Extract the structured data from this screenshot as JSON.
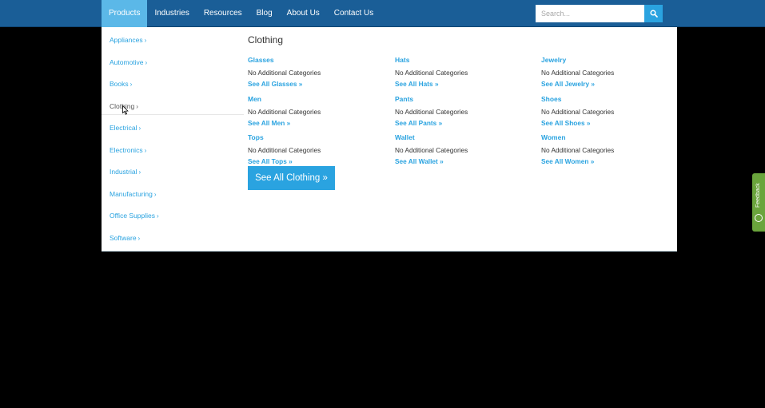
{
  "nav": {
    "items": [
      "Products",
      "Industries",
      "Resources",
      "Blog",
      "About Us",
      "Contact Us"
    ],
    "active_index": 0
  },
  "search": {
    "placeholder": "Search...",
    "icon": "search-icon"
  },
  "categories": {
    "items": [
      "Appliances",
      "Automotive",
      "Books",
      "Clothing",
      "Electrical",
      "Electronics",
      "Industrial",
      "Manufacturing",
      "Office Supplies",
      "Software"
    ],
    "active": "Clothing",
    "chevron": "›"
  },
  "content": {
    "title": "Clothing",
    "subcategories": [
      {
        "name": "Glasses",
        "note": "No Additional Categories",
        "see_all": "See All Glasses »"
      },
      {
        "name": "Hats",
        "note": "No Additional Categories",
        "see_all": "See All Hats »"
      },
      {
        "name": "Jewelry",
        "note": "No Additional Categories",
        "see_all": "See All Jewelry »"
      },
      {
        "name": "Men",
        "note": "No Additional Categories",
        "see_all": "See All Men »"
      },
      {
        "name": "Pants",
        "note": "No Additional Categories",
        "see_all": "See All Pants »"
      },
      {
        "name": "Shoes",
        "note": "No Additional Categories",
        "see_all": "See All Shoes »"
      },
      {
        "name": "Tops",
        "note": "No Additional Categories",
        "see_all": "See All Tops »"
      },
      {
        "name": "Wallet",
        "note": "No Additional Categories",
        "see_all": "See All Wallet »"
      },
      {
        "name": "Women",
        "note": "No Additional Categories",
        "see_all": "See All Women »"
      }
    ],
    "see_all_button": "See All Clothing »"
  },
  "feedback": {
    "label": "Feedback",
    "icon": "help-icon"
  },
  "colors": {
    "nav_bg": "#1a5e97",
    "accent": "#2aa3e0",
    "active_nav": "#5bb8e8",
    "feedback": "#6aa53c"
  }
}
